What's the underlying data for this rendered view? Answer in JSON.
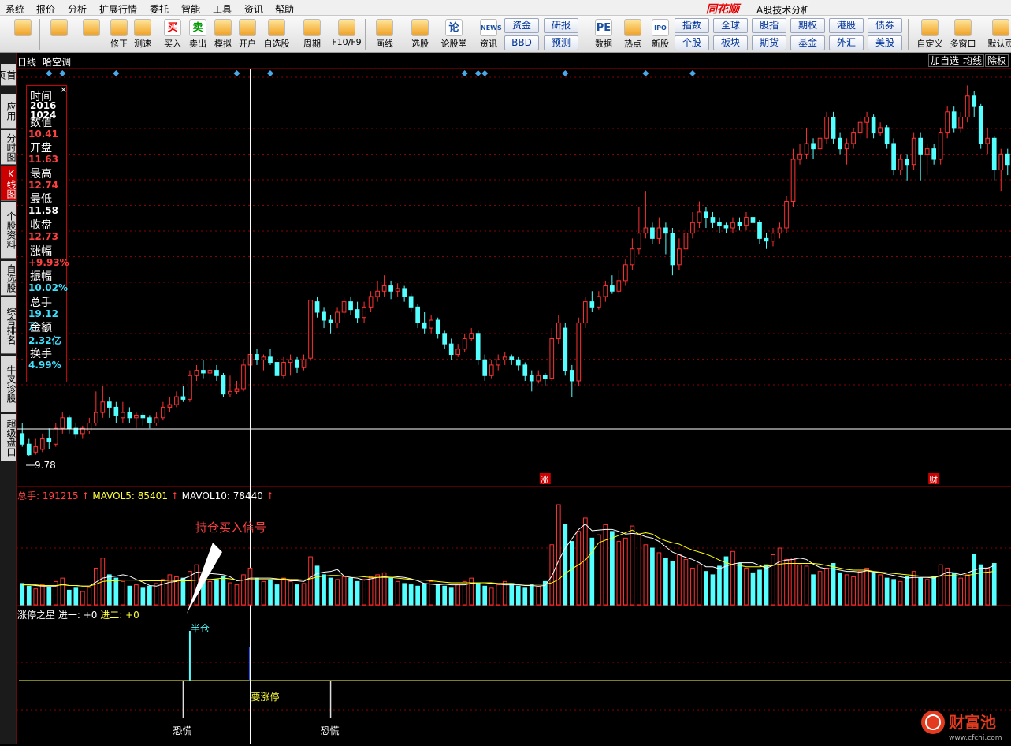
{
  "menu": [
    "系统",
    "报价",
    "分析",
    "扩展行情",
    "委托",
    "智能",
    "工具",
    "资讯",
    "帮助"
  ],
  "brand": "同花顺",
  "app_title": "A股技术分析",
  "toolbar": {
    "buttons": [
      {
        "label": "",
        "icon": "blocks-icon"
      },
      {
        "label": "",
        "icon": "back-arrow-icon"
      },
      {
        "label": "",
        "icon": "up-down-arrows-icon"
      },
      {
        "label": "修正",
        "icon": "refresh-icon"
      },
      {
        "label": "测速",
        "icon": "clock-icon"
      },
      {
        "label": "买入",
        "icon": "buy-icon",
        "glyph": "买"
      },
      {
        "label": "卖出",
        "icon": "sell-icon",
        "glyph": "卖"
      },
      {
        "label": "模拟",
        "icon": "hammer-icon"
      },
      {
        "label": "开户",
        "icon": "lock-icon"
      },
      {
        "label": "自选股",
        "icon": "star-icon"
      },
      {
        "label": "周期",
        "icon": "cycle-icon"
      },
      {
        "label": "F10/F9",
        "icon": "f10-icon"
      },
      {
        "label": "画线",
        "icon": "pen-icon"
      },
      {
        "label": "选股",
        "icon": "monitor-icon"
      },
      {
        "label": "论股堂",
        "icon": "forum-icon",
        "glyph": "论"
      },
      {
        "label": "资讯",
        "icon": "news-icon",
        "glyph": "NEWS"
      },
      {
        "label": "数据",
        "icon": "pe-icon",
        "glyph": "PE"
      },
      {
        "label": "热点",
        "icon": "fire-icon"
      },
      {
        "label": "新股",
        "icon": "ipo-icon",
        "glyph": "IPO"
      },
      {
        "label": "自定义",
        "icon": "custom-icon"
      },
      {
        "label": "多窗口",
        "icon": "multi-window-icon"
      },
      {
        "label": "默认页",
        "icon": "home-icon"
      }
    ],
    "grid": [
      [
        "资金",
        "研报"
      ],
      [
        "BBD",
        "预测"
      ],
      [
        "指数",
        "全球",
        "股指",
        "期权",
        "港股",
        "债券"
      ],
      [
        "个股",
        "板块",
        "期货",
        "基金",
        "外汇",
        "美股"
      ]
    ]
  },
  "sidebar": [
    "首页",
    "应用",
    "分时图",
    "K线图",
    "个股资料",
    "自选股",
    "综合排名",
    "牛叉诊股",
    "超级盘口"
  ],
  "chart_header": {
    "period": "日线",
    "indicator": "哈空调",
    "btn_add": "加自选",
    "btn_ma": "均线",
    "btn_exright": "除权"
  },
  "info_panel": [
    {
      "k": "时间",
      "v": "2016\n1024",
      "c": "#ffffff"
    },
    {
      "k": "数值",
      "v": "10.41",
      "c": "#ff4040"
    },
    {
      "k": "开盘",
      "v": "11.63",
      "c": "#ff4040"
    },
    {
      "k": "最高",
      "v": "12.74",
      "c": "#ff4040"
    },
    {
      "k": "最低",
      "v": "11.58",
      "c": "#ffffff"
    },
    {
      "k": "收盘",
      "v": "12.73",
      "c": "#ff4040"
    },
    {
      "k": "涨幅",
      "v": "+9.93%",
      "c": "#ff4040"
    },
    {
      "k": "振幅",
      "v": "10.02%",
      "c": "#40e0ff"
    },
    {
      "k": "总手",
      "v": "19.12万",
      "c": "#40e0ff"
    },
    {
      "k": "金额",
      "v": "2.32亿",
      "c": "#40e0ff"
    },
    {
      "k": "换手",
      "v": "4.99%",
      "c": "#40e0ff"
    }
  ],
  "low_mark": "9.78",
  "event_marks": [
    "涨",
    "财"
  ],
  "volume_header": {
    "total": "总手: 191215",
    "mavol5": "MAVOL5: 85401",
    "mavol10": "MAVOL10: 78440"
  },
  "annotation": "持仓买入信号",
  "indicator_header": {
    "name": "涨停之星",
    "jin1": "进一: +0",
    "jin2": "进二: +0"
  },
  "signal_half": "半仓",
  "signal_limitup": "要涨停",
  "signal_panic": [
    "恐慌",
    "恐慌"
  ],
  "watermark": {
    "name": "财富池",
    "url": "www.cfchi.com"
  },
  "colors": {
    "up": "#ff3232",
    "down": "#54ffff",
    "ma_white": "#ffffff",
    "ma_yellow": "#ffff00",
    "grid": "#8b0000"
  },
  "chart_data": {
    "type": "candlestick",
    "ohlc": [
      [
        10.2,
        10.0,
        10.4,
        9.95
      ],
      [
        10.0,
        9.8,
        10.1,
        9.78
      ],
      [
        9.85,
        9.95,
        10.1,
        9.8
      ],
      [
        9.9,
        10.1,
        10.2,
        9.85
      ],
      [
        10.1,
        10.05,
        10.3,
        9.9
      ],
      [
        10.0,
        10.3,
        10.4,
        9.95
      ],
      [
        10.3,
        10.5,
        10.6,
        10.2
      ],
      [
        10.5,
        10.3,
        10.55,
        10.2
      ],
      [
        10.3,
        10.2,
        10.4,
        10.1
      ],
      [
        10.2,
        10.3,
        10.35,
        10.1
      ],
      [
        10.25,
        10.4,
        10.5,
        10.2
      ],
      [
        10.4,
        10.6,
        11.0,
        10.35
      ],
      [
        10.6,
        10.8,
        11.1,
        10.5
      ],
      [
        10.8,
        10.7,
        10.9,
        10.5
      ],
      [
        10.7,
        10.55,
        10.8,
        10.4
      ],
      [
        10.5,
        10.6,
        10.8,
        10.4
      ],
      [
        10.6,
        10.5,
        10.7,
        10.4
      ],
      [
        10.5,
        10.55,
        10.6,
        10.3
      ],
      [
        10.55,
        10.5,
        10.6,
        10.35
      ],
      [
        10.5,
        10.4,
        10.55,
        10.3
      ],
      [
        10.4,
        10.5,
        10.6,
        10.35
      ],
      [
        10.5,
        10.7,
        10.8,
        10.45
      ],
      [
        10.7,
        10.75,
        10.9,
        10.6
      ],
      [
        10.75,
        10.9,
        11.0,
        10.7
      ],
      [
        10.9,
        10.85,
        11.1,
        10.8
      ],
      [
        10.85,
        11.3,
        11.4,
        10.8
      ],
      [
        11.3,
        11.4,
        11.5,
        11.2
      ],
      [
        11.4,
        11.35,
        11.6,
        11.25
      ],
      [
        11.35,
        11.4,
        11.5,
        11.2
      ],
      [
        11.4,
        11.3,
        11.5,
        11.2
      ],
      [
        11.3,
        10.95,
        11.35,
        10.9
      ],
      [
        10.95,
        11.0,
        11.3,
        10.9
      ],
      [
        11.0,
        11.05,
        11.2,
        10.95
      ],
      [
        11.05,
        11.5,
        11.6,
        11.0
      ],
      [
        11.5,
        11.7,
        11.95,
        11.45
      ],
      [
        11.7,
        11.6,
        11.8,
        11.5
      ],
      [
        11.6,
        11.65,
        11.7,
        11.4
      ],
      [
        11.65,
        11.55,
        11.8,
        11.5
      ],
      [
        11.55,
        11.3,
        11.6,
        11.2
      ],
      [
        11.3,
        11.55,
        11.65,
        11.25
      ],
      [
        11.55,
        11.6,
        11.7,
        11.3
      ],
      [
        11.6,
        11.45,
        11.65,
        11.35
      ],
      [
        11.45,
        11.6,
        11.7,
        11.4
      ],
      [
        11.63,
        12.73,
        12.74,
        11.58
      ],
      [
        12.7,
        12.5,
        12.8,
        12.4
      ],
      [
        12.5,
        12.35,
        12.6,
        12.2
      ],
      [
        12.35,
        12.3,
        12.45,
        12.1
      ],
      [
        12.3,
        12.5,
        12.6,
        12.2
      ],
      [
        12.5,
        12.7,
        12.8,
        12.4
      ],
      [
        12.7,
        12.55,
        12.8,
        12.45
      ],
      [
        12.55,
        12.4,
        12.7,
        12.3
      ],
      [
        12.4,
        12.6,
        12.7,
        12.3
      ],
      [
        12.6,
        12.8,
        12.9,
        12.5
      ],
      [
        12.8,
        12.9,
        13.1,
        12.7
      ],
      [
        12.9,
        13.0,
        13.2,
        12.8
      ],
      [
        13.0,
        12.9,
        13.1,
        12.75
      ],
      [
        12.9,
        12.95,
        13.05,
        12.8
      ],
      [
        12.95,
        12.8,
        13.0,
        12.7
      ],
      [
        12.8,
        12.6,
        12.85,
        12.5
      ],
      [
        12.6,
        12.3,
        12.65,
        12.2
      ],
      [
        12.3,
        12.2,
        12.5,
        12.1
      ],
      [
        12.2,
        12.35,
        12.45,
        12.1
      ],
      [
        12.35,
        12.1,
        12.4,
        12.0
      ],
      [
        12.1,
        11.9,
        12.15,
        11.8
      ],
      [
        11.9,
        11.7,
        12.0,
        11.6
      ],
      [
        11.7,
        11.8,
        11.9,
        11.65
      ],
      [
        11.8,
        12.0,
        12.1,
        11.75
      ],
      [
        12.0,
        12.1,
        12.2,
        11.95
      ],
      [
        12.1,
        11.6,
        12.15,
        11.5
      ],
      [
        11.6,
        11.3,
        11.7,
        11.2
      ],
      [
        11.3,
        11.5,
        11.6,
        11.25
      ],
      [
        11.5,
        11.6,
        11.7,
        11.4
      ],
      [
        11.6,
        11.65,
        11.75,
        11.5
      ],
      [
        11.65,
        11.6,
        11.7,
        11.5
      ],
      [
        11.6,
        11.5,
        11.65,
        11.4
      ],
      [
        11.5,
        11.3,
        11.55,
        11.2
      ],
      [
        11.3,
        11.2,
        11.4,
        11.0
      ],
      [
        11.2,
        11.3,
        11.4,
        11.15
      ],
      [
        11.3,
        11.25,
        11.35,
        11.1
      ],
      [
        11.25,
        12.0,
        12.2,
        11.2
      ],
      [
        12.0,
        12.3,
        12.45,
        11.9
      ],
      [
        12.2,
        11.4,
        12.3,
        11.3
      ],
      [
        11.4,
        11.2,
        11.5,
        10.9
      ],
      [
        11.2,
        12.3,
        12.4,
        11.1
      ],
      [
        12.3,
        12.7,
        12.8,
        12.2
      ],
      [
        12.7,
        12.6,
        12.9,
        12.5
      ],
      [
        12.6,
        12.8,
        12.9,
        12.55
      ],
      [
        12.8,
        13.0,
        13.1,
        12.7
      ],
      [
        13.0,
        12.9,
        13.2,
        12.85
      ],
      [
        12.9,
        13.1,
        13.3,
        12.85
      ],
      [
        13.1,
        13.4,
        13.5,
        13.0
      ],
      [
        13.4,
        13.7,
        13.9,
        13.3
      ],
      [
        13.7,
        14.0,
        14.5,
        13.6
      ],
      [
        14.0,
        14.1,
        14.8,
        13.9
      ],
      [
        14.1,
        13.9,
        14.2,
        13.8
      ],
      [
        13.9,
        14.1,
        14.3,
        13.8
      ],
      [
        14.1,
        14.0,
        14.2,
        13.6
      ],
      [
        14.0,
        13.4,
        14.1,
        13.2
      ],
      [
        13.4,
        13.7,
        13.9,
        13.3
      ],
      [
        13.7,
        14.0,
        14.1,
        13.6
      ],
      [
        14.0,
        14.2,
        14.4,
        13.9
      ],
      [
        14.2,
        14.4,
        14.6,
        14.1
      ],
      [
        14.4,
        14.3,
        14.5,
        14.1
      ],
      [
        14.3,
        14.2,
        14.4,
        14.1
      ],
      [
        14.2,
        14.15,
        14.3,
        14.0
      ],
      [
        14.15,
        14.1,
        14.2,
        14.0
      ],
      [
        14.1,
        14.2,
        14.3,
        14.0
      ],
      [
        14.2,
        14.15,
        14.3,
        14.05
      ],
      [
        14.15,
        14.3,
        14.4,
        14.05
      ],
      [
        14.3,
        14.2,
        14.45,
        14.1
      ],
      [
        14.2,
        13.9,
        14.25,
        13.8
      ],
      [
        13.9,
        13.85,
        14.0,
        13.7
      ],
      [
        13.85,
        14.0,
        14.1,
        13.75
      ],
      [
        14.0,
        14.1,
        14.2,
        13.9
      ],
      [
        14.1,
        14.6,
        14.7,
        14.0
      ],
      [
        14.6,
        15.4,
        15.6,
        14.5
      ],
      [
        15.4,
        15.5,
        15.7,
        15.3
      ],
      [
        15.5,
        15.7,
        16.0,
        15.4
      ],
      [
        15.7,
        15.6,
        15.8,
        15.4
      ],
      [
        15.6,
        15.8,
        15.9,
        15.5
      ],
      [
        15.8,
        16.2,
        16.3,
        15.7
      ],
      [
        16.2,
        15.8,
        16.3,
        15.7
      ],
      [
        15.8,
        15.6,
        15.9,
        15.5
      ],
      [
        15.6,
        15.7,
        15.8,
        15.3
      ],
      [
        15.7,
        15.9,
        16.0,
        15.6
      ],
      [
        15.9,
        16.1,
        16.2,
        15.8
      ],
      [
        16.1,
        16.2,
        16.3,
        15.8
      ],
      [
        16.2,
        15.9,
        16.25,
        15.8
      ],
      [
        15.9,
        16.0,
        16.1,
        15.85
      ],
      [
        16.0,
        15.7,
        16.05,
        15.6
      ],
      [
        15.7,
        15.2,
        15.8,
        15.1
      ],
      [
        15.2,
        15.4,
        15.5,
        15.1
      ],
      [
        15.4,
        15.3,
        15.5,
        15.0
      ],
      [
        15.3,
        15.8,
        15.9,
        15.2
      ],
      [
        15.8,
        15.5,
        15.9,
        15.0
      ],
      [
        15.5,
        15.6,
        15.7,
        15.1
      ],
      [
        15.6,
        15.4,
        15.7,
        15.3
      ],
      [
        15.4,
        15.9,
        16.0,
        15.3
      ],
      [
        15.9,
        16.3,
        16.4,
        15.8
      ],
      [
        16.3,
        16.0,
        16.4,
        15.9
      ],
      [
        16.0,
        16.2,
        16.3,
        15.9
      ],
      [
        16.2,
        16.6,
        16.8,
        16.1
      ],
      [
        16.6,
        16.4,
        16.7,
        16.2
      ],
      [
        16.4,
        15.7,
        16.45,
        15.6
      ],
      [
        15.7,
        15.8,
        16.0,
        15.5
      ],
      [
        15.8,
        15.2,
        15.85,
        15.0
      ],
      [
        15.2,
        15.5,
        15.6,
        14.8
      ],
      [
        15.5,
        15.3,
        15.6,
        15.1
      ]
    ],
    "volume": [
      32,
      28,
      24,
      30,
      26,
      35,
      40,
      22,
      25,
      20,
      26,
      55,
      70,
      45,
      40,
      35,
      28,
      30,
      25,
      28,
      32,
      38,
      45,
      42,
      40,
      50,
      60,
      45,
      35,
      38,
      42,
      33,
      30,
      45,
      55,
      40,
      35,
      38,
      30,
      40,
      35,
      30,
      32,
      72,
      58,
      45,
      40,
      38,
      42,
      40,
      35,
      38,
      42,
      45,
      48,
      40,
      35,
      32,
      30,
      28,
      32,
      35,
      30,
      28,
      25,
      30,
      35,
      40,
      32,
      28,
      25,
      30,
      35,
      32,
      28,
      25,
      30,
      28,
      35,
      90,
      150,
      120,
      95,
      110,
      130,
      100,
      105,
      120,
      110,
      95,
      100,
      118,
      105,
      90,
      85,
      78,
      70,
      65,
      75,
      68,
      55,
      60,
      50,
      45,
      58,
      72,
      80,
      62,
      55,
      48,
      52,
      60,
      75,
      85,
      68,
      70,
      60,
      58,
      45,
      50,
      55,
      62,
      48,
      45,
      42,
      50,
      55,
      48,
      45,
      40,
      38,
      35,
      42,
      50,
      40,
      38,
      42,
      60,
      55,
      48,
      40,
      45,
      75,
      60,
      55,
      62
    ],
    "mavol5": [
      30,
      30,
      29,
      28,
      28,
      28,
      31,
      29,
      29,
      28,
      28,
      34,
      40,
      42,
      43,
      45,
      43,
      38,
      34,
      29,
      28,
      31,
      34,
      35,
      39,
      43,
      49,
      48,
      47,
      46,
      45,
      42,
      36,
      37,
      40,
      40,
      40,
      40,
      39,
      38,
      36,
      36,
      35,
      41,
      47,
      49,
      50,
      53,
      43,
      41,
      40,
      37,
      39,
      41,
      42,
      43,
      42,
      41,
      39,
      36,
      32,
      31,
      30,
      31,
      30,
      30,
      30,
      32,
      33,
      33,
      32,
      31,
      30,
      30,
      30,
      29,
      29,
      28,
      29,
      43,
      66,
      85,
      99,
      113,
      121,
      111,
      112,
      113,
      113,
      110,
      106,
      107,
      106,
      102,
      100,
      95,
      87,
      79,
      75,
      71,
      68,
      63,
      57,
      57,
      54,
      58,
      61,
      63,
      63,
      63,
      59,
      55,
      59,
      65,
      67,
      68,
      70,
      68,
      61,
      56,
      54,
      54,
      52,
      50,
      50,
      49,
      51,
      49,
      48,
      46,
      44,
      42,
      40,
      41,
      41,
      41,
      40,
      44,
      49,
      48,
      45,
      48,
      52,
      55,
      55,
      59
    ],
    "mavol10": [
      30,
      30,
      30,
      29,
      29,
      29,
      30,
      29,
      29,
      28,
      28,
      31,
      35,
      36,
      36,
      37,
      37,
      37,
      36,
      36,
      36,
      36,
      37,
      36,
      36,
      36,
      37,
      38,
      38,
      39,
      40,
      39,
      37,
      37,
      38,
      38,
      38,
      38,
      38,
      39,
      38,
      38,
      37,
      39,
      42,
      43,
      44,
      44,
      43,
      43,
      43,
      42,
      41,
      41,
      41,
      41,
      40,
      39,
      38,
      37,
      37,
      36,
      35,
      34,
      33,
      33,
      33,
      33,
      33,
      33,
      33,
      32,
      32,
      32,
      31,
      31,
      31,
      31,
      31,
      33,
      38,
      47,
      54,
      60,
      67,
      79,
      93,
      97,
      100,
      104,
      108,
      112,
      106,
      108,
      106,
      100,
      96,
      93,
      91,
      86,
      82,
      79,
      76,
      72,
      67,
      63,
      60,
      59,
      57,
      57,
      57,
      58,
      59,
      61,
      62,
      62,
      62,
      62,
      62,
      61,
      59,
      57,
      55,
      53,
      52,
      52,
      52,
      50,
      49,
      48,
      47,
      46,
      45,
      44,
      43,
      43,
      42,
      43,
      44,
      44,
      43,
      44,
      46,
      48,
      49,
      50
    ],
    "half_signal_index": 25,
    "cursor_index": 34,
    "panic_indices": [
      24,
      46
    ],
    "limitup_text_index": 34,
    "top_markers": [
      4,
      6,
      14,
      32,
      37,
      66,
      68,
      69,
      81,
      93,
      100
    ]
  }
}
